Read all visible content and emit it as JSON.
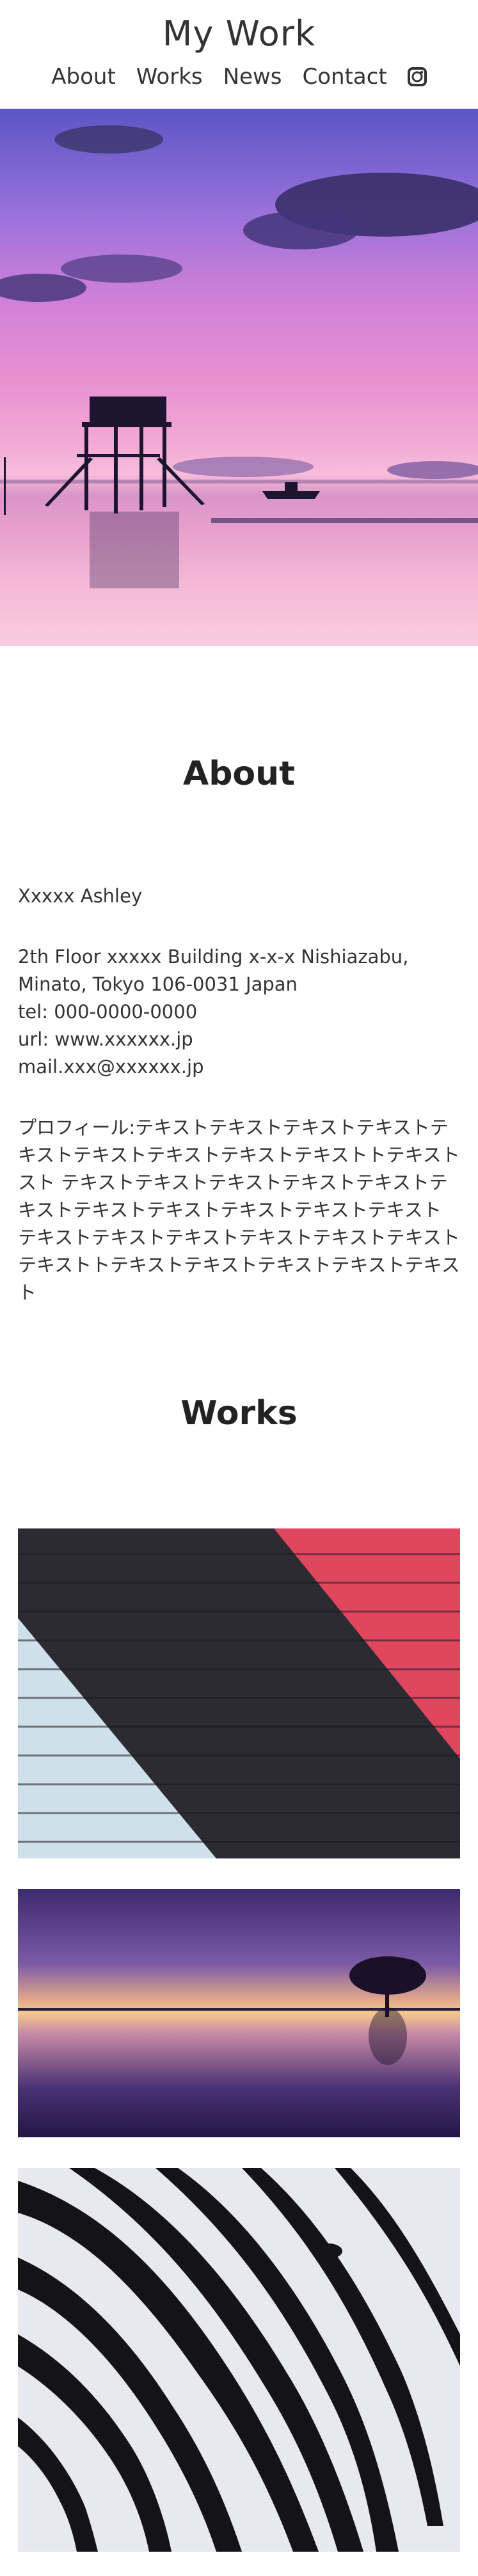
{
  "header": {
    "title": "My Work",
    "nav": [
      "About",
      "Works",
      "News",
      "Contact"
    ],
    "social_icon": "instagram-icon"
  },
  "hero": {
    "alt": "Sunset over pier with stilt house"
  },
  "about": {
    "title": "About",
    "name": "Xxxxx Ashley",
    "address_lines": [
      "2th Floor xxxxx Building x-x-x Nishiazabu,",
      "Minato, Tokyo 106-0031 Japan",
      "tel: 000-0000-0000",
      "url: www.xxxxxx.jp",
      "mail.xxx@xxxxxx.jp"
    ],
    "profile": "プロフィール:テキストテキストテキストテキストテキストテキストテキストテキストテキストトテキストスト テキストテキストテキストテキストテキストテキストテキストテキストテキストテキストテキスト テキストテキストテキストテキストテキストテキストテキストトテキストテキストテキストテキストテキスト"
  },
  "works": {
    "title": "Works",
    "items": [
      "brick-wall-painting",
      "sunset-tree-lake",
      "zebra-closeup"
    ]
  },
  "colors": {
    "text": "#333333",
    "heading": "#222222"
  }
}
